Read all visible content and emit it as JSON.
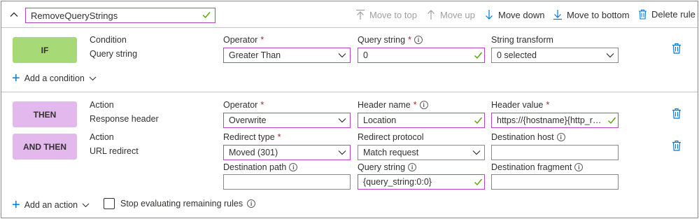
{
  "rule": {
    "name": "RemoveQueryStrings"
  },
  "toolbar": {
    "move_to_top": "Move to top",
    "move_up": "Move up",
    "move_down": "Move down",
    "move_to_bottom": "Move to bottom",
    "delete_rule": "Delete rule"
  },
  "colors": {
    "accent": "#0078d4",
    "valid_border": "#b146c2",
    "if_pill": "#a7d977",
    "then_pill": "#e3b8ec",
    "check": "#57a300",
    "required": "#a4262c"
  },
  "condition": {
    "pill": "IF",
    "kind": "Condition",
    "name": "Query string",
    "operator_label": "Operator",
    "operator_value": "Greater Than",
    "query_label": "Query string",
    "query_value": "0",
    "transform_label": "String transform",
    "transform_value": "0 selected",
    "add_condition": "Add a condition"
  },
  "action1": {
    "pill": "THEN",
    "kind": "Action",
    "name": "Response header",
    "operator_label": "Operator",
    "operator_value": "Overwrite",
    "header_name_label": "Header name",
    "header_name_value": "Location",
    "header_value_label": "Header value",
    "header_value_value": "https://{hostname}{http_res..."
  },
  "action2": {
    "pill": "AND THEN",
    "kind": "Action",
    "name": "URL redirect",
    "redirect_type_label": "Redirect type",
    "redirect_type_value": "Moved (301)",
    "redirect_protocol_label": "Redirect protocol",
    "redirect_protocol_value": "Match request",
    "dest_host_label": "Destination host",
    "dest_host_value": "",
    "dest_path_label": "Destination path",
    "dest_path_value": "",
    "query_label": "Query string",
    "query_value": "{query_string:0:0}",
    "dest_fragment_label": "Destination fragment",
    "dest_fragment_value": ""
  },
  "footer": {
    "add_action": "Add an action",
    "stop_label": "Stop evaluating remaining rules"
  }
}
